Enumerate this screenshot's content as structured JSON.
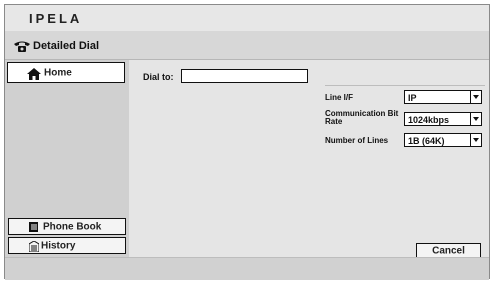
{
  "brand": "IPELA",
  "window": {
    "title": "Detailed Dial"
  },
  "sidebar": {
    "home_label": "Home",
    "phone_book_label": "Phone Book",
    "history_label": "History"
  },
  "dial": {
    "label": "Dial to:",
    "value": "",
    "placeholder": ""
  },
  "settings": {
    "line_if": {
      "label": "Line I/F",
      "value": "IP"
    },
    "bit_rate": {
      "label": "Communication Bit Rate",
      "value": "1024kbps"
    },
    "num_lines": {
      "label": "Number of Lines",
      "value": "1B (64K)"
    }
  },
  "actions": {
    "cancel_label": "Cancel"
  },
  "icons": {
    "title": "phone-icon",
    "home": "home-icon",
    "phone_book": "book-icon",
    "history": "history-icon"
  }
}
